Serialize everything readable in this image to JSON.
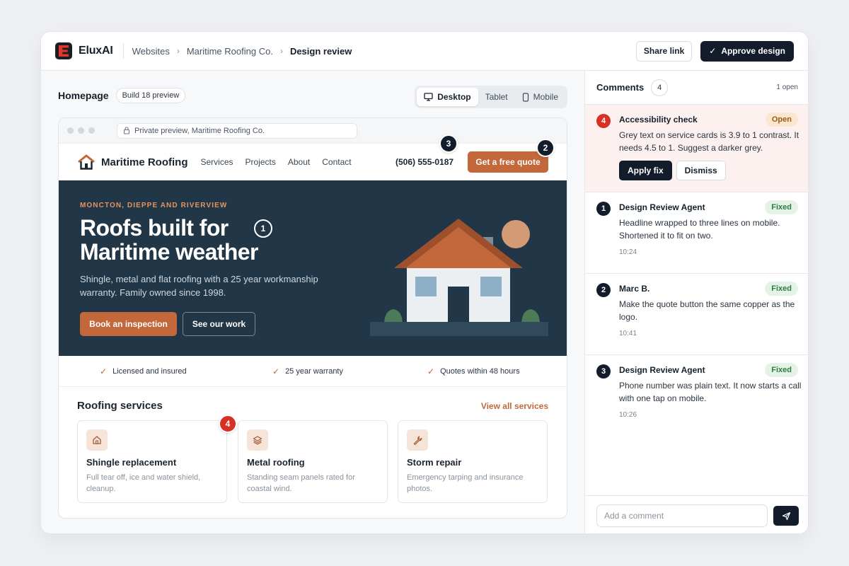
{
  "app": {
    "brand": "EluxAI",
    "breadcrumbs": [
      "Websites",
      "Maritime Roofing Co.",
      "Design review"
    ],
    "share_label": "Share link",
    "approve_label": "Approve design"
  },
  "workspace": {
    "title": "Homepage",
    "build_pill": "Build 18 preview",
    "devices": [
      {
        "label": "Desktop",
        "icon": "monitor-icon",
        "active": true
      },
      {
        "label": "Tablet",
        "icon": "",
        "active": false
      },
      {
        "label": "Mobile",
        "icon": "phone-icon",
        "active": false
      }
    ],
    "url": "Private preview, Maritime Roofing Co."
  },
  "site": {
    "logo_text": "Maritime Roofing",
    "nav": [
      "Services",
      "Projects",
      "About",
      "Contact"
    ],
    "phone": "(506) 555-0187",
    "quote_button": "Get a free quote",
    "hero": {
      "eyebrow": "MONCTON, DIEPPE AND RIVERVIEW",
      "title_line1": "Roofs built for",
      "title_line2": "Maritime weather",
      "subtitle": "Shingle, metal and flat roofing with a 25 year workmanship warranty. Family owned since 1998.",
      "primary_button": "Book an inspection",
      "secondary_button": "See our work"
    },
    "trust": [
      "Licensed and insured",
      "25 year warranty",
      "Quotes within 48 hours"
    ],
    "services_heading": "Roofing services",
    "services_link": "View all services",
    "services": [
      {
        "title": "Shingle replacement",
        "desc": "Full tear off, ice and water shield, cleanup.",
        "icon": "home-icon"
      },
      {
        "title": "Metal roofing",
        "desc": "Standing seam panels rated for coastal wind.",
        "icon": "layers-icon"
      },
      {
        "title": "Storm repair",
        "desc": "Emergency tarping and insurance photos.",
        "icon": "wrench-icon"
      }
    ]
  },
  "annotations": {
    "hero_title": "1",
    "quote_button": "2",
    "phone": "3",
    "service_card": "4"
  },
  "comments": {
    "title": "Comments",
    "count": "4",
    "open_label": "1 open",
    "items": [
      {
        "num": "4",
        "author": "Accessibility check",
        "status": "Open",
        "body": "Grey text on service cards is 3.9 to 1 contrast. It needs 4.5 to 1. Suggest a darker grey.",
        "fix_label": "Apply fix",
        "dismiss_label": "Dismiss"
      },
      {
        "num": "1",
        "author": "Design Review Agent",
        "status": "Fixed",
        "body": "Headline wrapped to three lines on mobile. Shortened it to fit on two.",
        "time": "10:24"
      },
      {
        "num": "2",
        "author": "Marc B.",
        "status": "Fixed",
        "body": "Make the quote button the same copper as the logo.",
        "time": "10:41"
      },
      {
        "num": "3",
        "author": "Design Review Agent",
        "status": "Fixed",
        "body": "Phone number was plain text. It now starts a call with one tap on mobile.",
        "time": "10:26"
      }
    ],
    "input_placeholder": "Add a comment"
  },
  "colors": {
    "accent_copper": "#c2683b",
    "hero_navy": "#213646",
    "dark_button": "#131c2b",
    "alert_red": "#d93025",
    "fixed_green": "#2f7a45"
  }
}
